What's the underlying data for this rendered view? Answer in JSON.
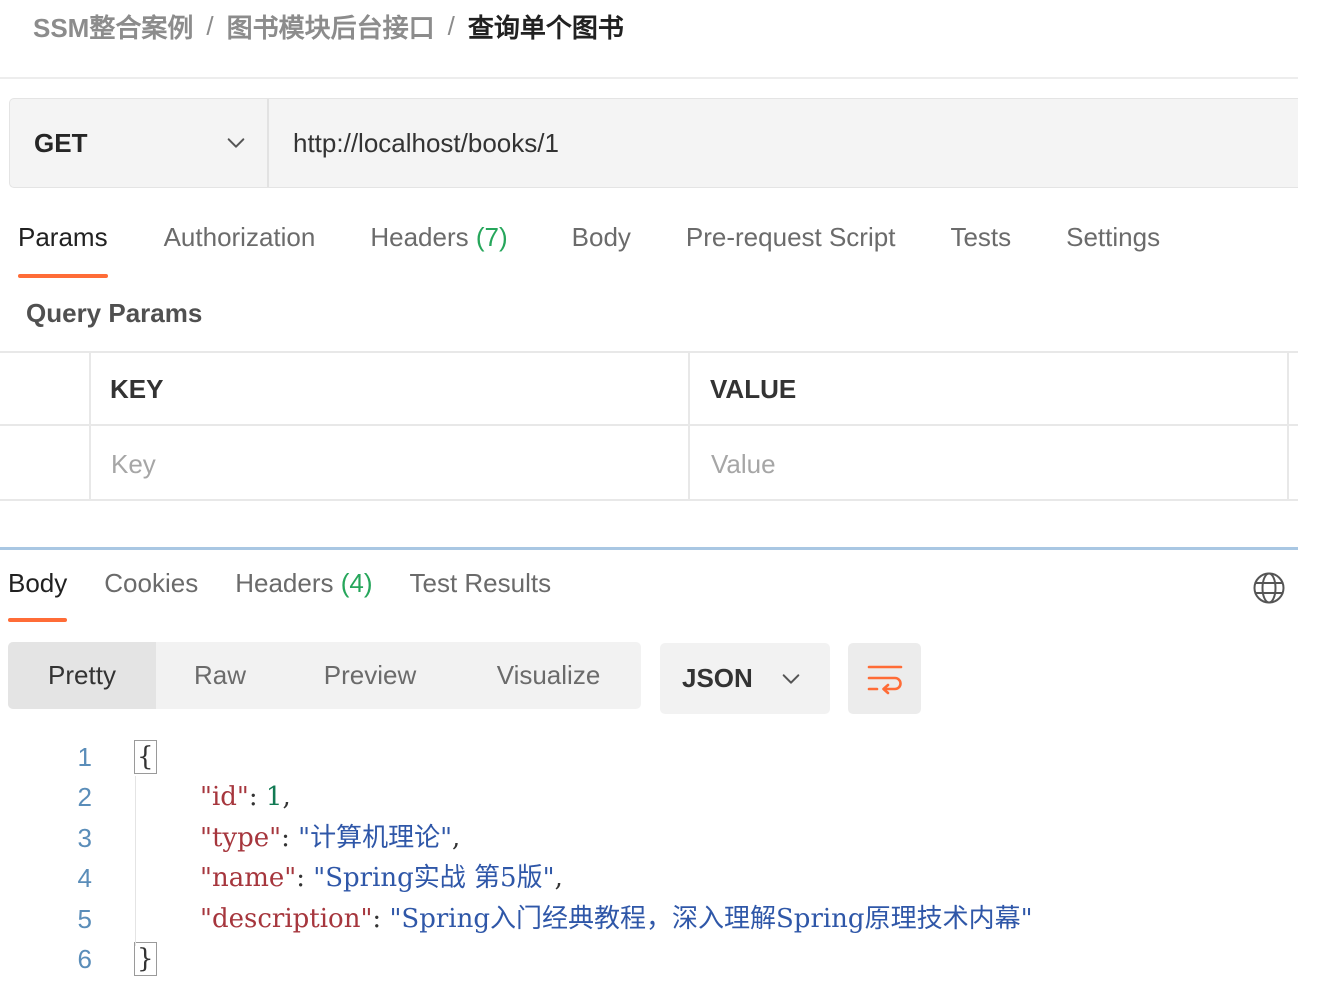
{
  "breadcrumb": {
    "items": [
      "SSM整合案例",
      "图书模块后台接口",
      "查询单个图书"
    ],
    "separator": "/"
  },
  "request": {
    "method": "GET",
    "url": "http://localhost/books/1"
  },
  "request_tabs": [
    {
      "label": "Params",
      "count": "",
      "active": true
    },
    {
      "label": "Authorization",
      "count": "",
      "active": false
    },
    {
      "label": "Headers",
      "count": "(7)",
      "active": false
    },
    {
      "label": "Body",
      "count": "",
      "active": false
    },
    {
      "label": "Pre-request Script",
      "count": "",
      "active": false
    },
    {
      "label": "Tests",
      "count": "",
      "active": false
    },
    {
      "label": "Settings",
      "count": "",
      "active": false
    }
  ],
  "query_params": {
    "title": "Query Params",
    "columns": [
      "KEY",
      "VALUE"
    ],
    "key_placeholder": "Key",
    "value_placeholder": "Value"
  },
  "response_tabs": [
    {
      "label": "Body",
      "count": "",
      "active": true
    },
    {
      "label": "Cookies",
      "count": "",
      "active": false
    },
    {
      "label": "Headers",
      "count": "(4)",
      "active": false
    },
    {
      "label": "Test Results",
      "count": "",
      "active": false
    }
  ],
  "format_tabs": [
    {
      "label": "Pretty",
      "active": true
    },
    {
      "label": "Raw",
      "active": false
    },
    {
      "label": "Preview",
      "active": false
    },
    {
      "label": "Visualize",
      "active": false
    }
  ],
  "format_select": "JSON",
  "code": {
    "open_brace": "{",
    "close_brace": "}",
    "line_numbers": [
      "1",
      "2",
      "3",
      "4",
      "5",
      "6"
    ],
    "fields": [
      {
        "key": "\"id\"",
        "value": "1",
        "kind": "number",
        "comma": ","
      },
      {
        "key": "\"type\"",
        "value": "\"计算机理论\"",
        "kind": "string",
        "comma": ","
      },
      {
        "key": "\"name\"",
        "value": "\"Spring实战 第5版\"",
        "kind": "string",
        "comma": ","
      },
      {
        "key": "\"description\"",
        "value": "\"Spring入门经典教程，深入理解Spring原理技术内幕\"",
        "kind": "string",
        "comma": ""
      }
    ]
  },
  "colors": {
    "accent": "#ff6c37",
    "count": "#26a65b",
    "json_key": "#a6363d",
    "json_string": "#2f57a8",
    "json_number": "#127a53",
    "line_number": "#5a8db9"
  },
  "icons": {
    "method_dropdown": "chevron-down-icon",
    "format_dropdown": "chevron-down-icon",
    "wrap": "wrap-lines-icon",
    "globe": "globe-icon"
  }
}
